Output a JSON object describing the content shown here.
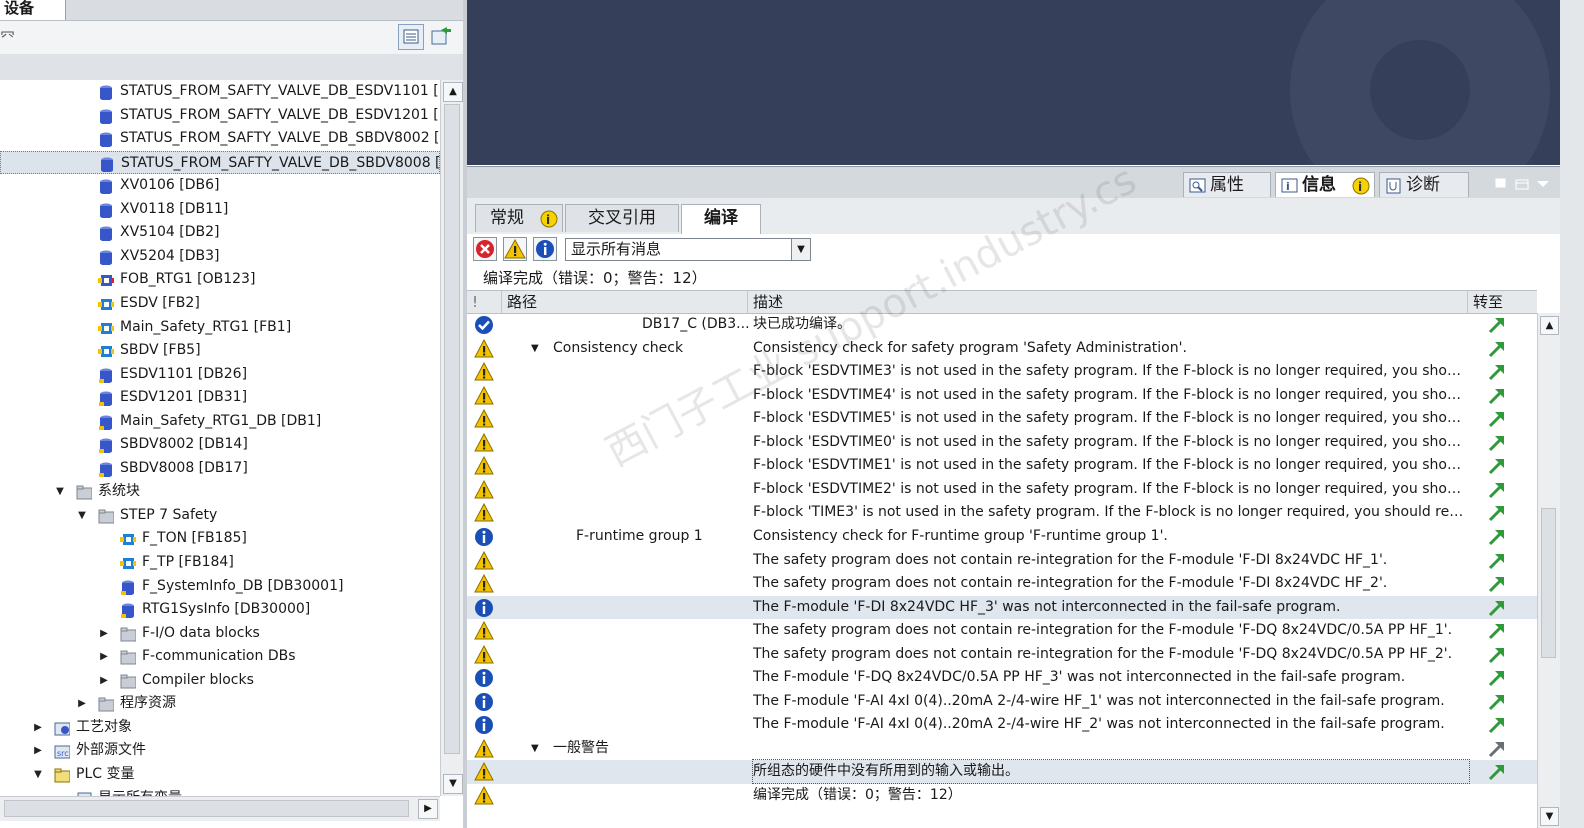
{
  "left_panel": {
    "tab_label": "设备",
    "toolbar_glyph": "㓁",
    "tree": [
      {
        "label": "STATUS_FROM_SAFTY_VALVE_DB_ESDV1101 [...",
        "icon": "db-icon",
        "indent": 1,
        "arrow": ""
      },
      {
        "label": "STATUS_FROM_SAFTY_VALVE_DB_ESDV1201 [...",
        "icon": "db-icon",
        "indent": 1,
        "arrow": ""
      },
      {
        "label": "STATUS_FROM_SAFTY_VALVE_DB_SBDV8002 [...",
        "icon": "db-icon",
        "indent": 1,
        "arrow": ""
      },
      {
        "label": "STATUS_FROM_SAFTY_VALVE_DB_SBDV8008 [...",
        "icon": "db-icon",
        "indent": 1,
        "arrow": "",
        "selected": true
      },
      {
        "label": "XV0106 [DB6]",
        "icon": "db-icon",
        "indent": 1,
        "arrow": ""
      },
      {
        "label": "XV0118 [DB11]",
        "icon": "db-icon",
        "indent": 1,
        "arrow": ""
      },
      {
        "label": "XV5104 [DB2]",
        "icon": "db-icon",
        "indent": 1,
        "arrow": ""
      },
      {
        "label": "XV5204 [DB3]",
        "icon": "db-icon",
        "indent": 1,
        "arrow": ""
      },
      {
        "label": "FOB_RTG1 [OB123]",
        "icon": "ob-icon",
        "indent": 1,
        "arrow": ""
      },
      {
        "label": "ESDV [FB2]",
        "icon": "fb-icon",
        "indent": 1,
        "arrow": ""
      },
      {
        "label": "Main_Safety_RTG1 [FB1]",
        "icon": "fb-icon",
        "indent": 1,
        "arrow": ""
      },
      {
        "label": "SBDV [FB5]",
        "icon": "fb-icon",
        "indent": 1,
        "arrow": ""
      },
      {
        "label": "ESDV1101 [DB26]",
        "icon": "db-yellow-icon",
        "indent": 1,
        "arrow": ""
      },
      {
        "label": "ESDV1201 [DB31]",
        "icon": "db-yellow-icon",
        "indent": 1,
        "arrow": ""
      },
      {
        "label": "Main_Safety_RTG1_DB [DB1]",
        "icon": "db-yellow-icon",
        "indent": 1,
        "arrow": ""
      },
      {
        "label": "SBDV8002 [DB14]",
        "icon": "db-yellow-icon",
        "indent": 1,
        "arrow": ""
      },
      {
        "label": "SBDV8008 [DB17]",
        "icon": "db-yellow-icon",
        "indent": 1,
        "arrow": ""
      },
      {
        "label": "系统块",
        "icon": "folder-icon",
        "indent": 0,
        "arrow": "▼"
      },
      {
        "label": "STEP 7 Safety",
        "icon": "folder-icon",
        "indent": 1,
        "arrow": "▼"
      },
      {
        "label": "F_TON [FB185]",
        "icon": "fb-icon",
        "indent": 2,
        "arrow": ""
      },
      {
        "label": "F_TP [FB184]",
        "icon": "fb-icon",
        "indent": 2,
        "arrow": ""
      },
      {
        "label": "F_SystemInfo_DB [DB30001]",
        "icon": "db-yellow-icon",
        "indent": 2,
        "arrow": ""
      },
      {
        "label": "RTG1SysInfo [DB30000]",
        "icon": "db-yellow-icon",
        "indent": 2,
        "arrow": ""
      },
      {
        "label": "F-I/O data blocks",
        "icon": "folder-icon",
        "indent": 2,
        "arrow": "▶"
      },
      {
        "label": "F-communication DBs",
        "icon": "folder-icon",
        "indent": 2,
        "arrow": "▶"
      },
      {
        "label": "Compiler blocks",
        "icon": "folder-icon",
        "indent": 2,
        "arrow": "▶"
      },
      {
        "label": "程序资源",
        "icon": "folder-icon",
        "indent": 1,
        "arrow": "▶"
      },
      {
        "label": "工艺对象",
        "icon": "tech-object-icon",
        "indent": -1,
        "arrow": "▶"
      },
      {
        "label": "外部源文件",
        "icon": "external-source-icon",
        "indent": -1,
        "arrow": "▶"
      },
      {
        "label": "PLC 变量",
        "icon": "plc-tags-icon",
        "indent": -1,
        "arrow": "▼"
      },
      {
        "label": "显示所有变量",
        "icon": "tags-icon",
        "indent": 0,
        "arrow": ""
      }
    ]
  },
  "inspector": {
    "tabs": [
      {
        "label": "属性",
        "icon": "properties-icon"
      },
      {
        "label": "信息",
        "icon": "info-tab-icon",
        "active": true
      },
      {
        "label": "诊断",
        "icon": "diagnostics-icon"
      }
    ],
    "subtabs": [
      {
        "label": "常规"
      },
      {
        "label": "交叉引用"
      },
      {
        "label": "编译",
        "active": true
      }
    ],
    "filter": {
      "value": "显示所有消息"
    },
    "status": "编译完成（错误：0；警告：12）",
    "columns": {
      "flag": "!",
      "path": "路径",
      "desc": "描述",
      "goto": "转至"
    }
  },
  "messages": [
    {
      "type": "ok",
      "path": "DB17_C (DB3...",
      "path_indent": 175,
      "arrow": "",
      "desc": "块已成功编译。"
    },
    {
      "type": "warn",
      "path": "Consistency check",
      "path_indent": 86,
      "arrow": "▼",
      "desc": "Consistency check for safety program 'Safety Administration'."
    },
    {
      "type": "warn",
      "path": "",
      "path_indent": 0,
      "arrow": "",
      "desc": "F-block 'ESDVTIME3' is not used in the safety program. If the F-block is no longer required, you should rem..."
    },
    {
      "type": "warn",
      "path": "",
      "path_indent": 0,
      "arrow": "",
      "desc": "F-block 'ESDVTIME4' is not used in the safety program. If the F-block is no longer required, you should rem..."
    },
    {
      "type": "warn",
      "path": "",
      "path_indent": 0,
      "arrow": "",
      "desc": "F-block 'ESDVTIME5' is not used in the safety program. If the F-block is no longer required, you should rem..."
    },
    {
      "type": "warn",
      "path": "",
      "path_indent": 0,
      "arrow": "",
      "desc": "F-block 'ESDVTIME0' is not used in the safety program. If the F-block is no longer required, you should rem..."
    },
    {
      "type": "warn",
      "path": "",
      "path_indent": 0,
      "arrow": "",
      "desc": "F-block 'ESDVTIME1' is not used in the safety program. If the F-block is no longer required, you should rem..."
    },
    {
      "type": "warn",
      "path": "",
      "path_indent": 0,
      "arrow": "",
      "desc": "F-block 'ESDVTIME2' is not used in the safety program. If the F-block is no longer required, you should rem..."
    },
    {
      "type": "warn",
      "path": "",
      "path_indent": 0,
      "arrow": "",
      "desc": "F-block 'TIME3' is not used in the safety program. If the F-block is no longer required, you should remove i..."
    },
    {
      "type": "info",
      "path": "F-runtime group 1",
      "path_indent": 109,
      "arrow": "",
      "desc": "Consistency check for F-runtime group 'F-runtime group 1'."
    },
    {
      "type": "warn",
      "path": "",
      "path_indent": 0,
      "arrow": "",
      "desc": "The safety program does not contain re-integration for the F-module 'F-DI 8x24VDC HF_1'."
    },
    {
      "type": "warn",
      "path": "",
      "path_indent": 0,
      "arrow": "",
      "desc": "The safety program does not contain re-integration for the F-module 'F-DI 8x24VDC HF_2'."
    },
    {
      "type": "info",
      "path": "",
      "path_indent": 0,
      "arrow": "",
      "desc": "The F-module 'F-DI 8x24VDC HF_3' was not interconnected in the fail-safe program.",
      "highlight": true
    },
    {
      "type": "warn",
      "path": "",
      "path_indent": 0,
      "arrow": "",
      "desc": "The safety program does not contain re-integration for the F-module 'F-DQ 8x24VDC/0.5A PP HF_1'."
    },
    {
      "type": "warn",
      "path": "",
      "path_indent": 0,
      "arrow": "",
      "desc": "The safety program does not contain re-integration for the F-module 'F-DQ 8x24VDC/0.5A PP HF_2'."
    },
    {
      "type": "info",
      "path": "",
      "path_indent": 0,
      "arrow": "",
      "desc": "The F-module 'F-DQ 8x24VDC/0.5A PP HF_3' was not interconnected in the fail-safe program."
    },
    {
      "type": "info",
      "path": "",
      "path_indent": 0,
      "arrow": "",
      "desc": "The F-module 'F-AI 4xI 0(4)..20mA 2-/4-wire HF_1' was not interconnected in the fail-safe program."
    },
    {
      "type": "info",
      "path": "",
      "path_indent": 0,
      "arrow": "",
      "desc": "The F-module 'F-AI 4xI 0(4)..20mA 2-/4-wire HF_2' was not interconnected in the fail-safe program."
    },
    {
      "type": "warn",
      "path": "一般警告",
      "path_indent": 86,
      "arrow": "▼",
      "desc": "",
      "goto_gray": true
    },
    {
      "type": "warn",
      "path": "",
      "path_indent": 0,
      "arrow": "",
      "desc": "所组态的硬件中没有所用到的输入或输出。",
      "selected": true
    },
    {
      "type": "warn",
      "path": "",
      "path_indent": 0,
      "arrow": "",
      "desc": "编译完成（错误：0；警告：12）",
      "no_goto": true
    }
  ],
  "watermark": "西门子工业 support.industry.cs",
  "colors": {
    "error": "#d7232b",
    "warning": "#f3c300",
    "info": "#1b4fb8",
    "ok": "#1b4fb8",
    "goto": "#2e9a3a",
    "banner": "#353f59"
  }
}
